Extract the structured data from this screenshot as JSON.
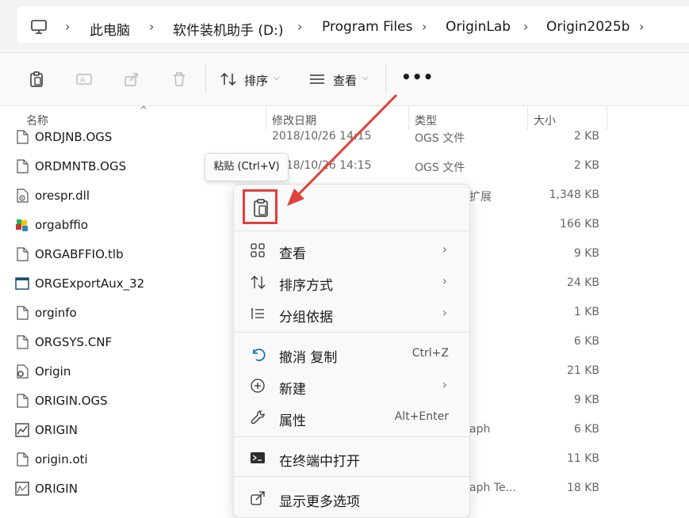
{
  "address": {
    "crumbs": [
      "此电脑",
      "软件装机助手 (D:)",
      "Program Files",
      "OriginLab",
      "Origin2025b"
    ]
  },
  "toolbar": {
    "sort_label": "排序",
    "view_label": "查看",
    "more_label": "•••"
  },
  "columns": {
    "name": "名称",
    "date": "修改日期",
    "type": "类型",
    "size": "大小"
  },
  "files": [
    {
      "name": "ORDJNB.OGS",
      "date": "2018/10/26 14:15",
      "type": "OGS 文件",
      "size": "2 KB",
      "icon": "file-icon"
    },
    {
      "name": "ORDMNTB.OGS",
      "date": "2018/10/26 14:15",
      "type": "OGS 文件",
      "size": "2 KB",
      "icon": "file-icon"
    },
    {
      "name": "orespr.dll",
      "date": "",
      "type": "扩展",
      "size": "1,348 KB",
      "icon": "dll-icon"
    },
    {
      "name": "orgabffio",
      "date": "",
      "type": "",
      "size": "166 KB",
      "icon": "app-color-icon"
    },
    {
      "name": "ORGABFFIO.tlb",
      "date": "",
      "type": "",
      "size": "9 KB",
      "icon": "file-icon"
    },
    {
      "name": "ORGExportAux_32",
      "date": "",
      "type": "",
      "size": "24 KB",
      "icon": "window-app-icon"
    },
    {
      "name": "orginfo",
      "date": "",
      "type": "",
      "size": "1 KB",
      "icon": "file-icon"
    },
    {
      "name": "ORGSYS.CNF",
      "date": "",
      "type": "",
      "size": "6 KB",
      "icon": "file-icon"
    },
    {
      "name": "Origin",
      "date": "",
      "type": "",
      "size": "21 KB",
      "icon": "settings-file-icon"
    },
    {
      "name": "ORIGIN.OGS",
      "date": "",
      "type": "",
      "size": "9 KB",
      "icon": "file-icon"
    },
    {
      "name": "ORIGIN",
      "date": "",
      "type": "aph",
      "size": "6 KB",
      "icon": "graph-app-icon"
    },
    {
      "name": "origin.oti",
      "date": "",
      "type": "",
      "size": "11 KB",
      "icon": "file-icon"
    },
    {
      "name": "ORIGIN",
      "date": "",
      "type": "aph Te...",
      "size": "18 KB",
      "icon": "graph-template-icon"
    }
  ],
  "tooltip": "粘贴 (Ctrl+V)",
  "menu": {
    "items": [
      {
        "label": "查看",
        "shortcut": "",
        "submenu": true,
        "icon": "grid-icon"
      },
      {
        "label": "排序方式",
        "shortcut": "",
        "submenu": true,
        "icon": "sort-icon"
      },
      {
        "label": "分组依据",
        "shortcut": "",
        "submenu": true,
        "icon": "group-icon"
      },
      {
        "label": "撤消 复制",
        "shortcut": "Ctrl+Z",
        "submenu": false,
        "icon": "undo-icon"
      },
      {
        "label": "新建",
        "shortcut": "",
        "submenu": true,
        "icon": "plus-circle-icon"
      },
      {
        "label": "属性",
        "shortcut": "Alt+Enter",
        "submenu": false,
        "icon": "wrench-icon"
      },
      {
        "label": "在终端中打开",
        "shortcut": "",
        "submenu": false,
        "icon": "terminal-icon"
      },
      {
        "label": "显示更多选项",
        "shortcut": "",
        "submenu": false,
        "icon": "share-icon"
      }
    ]
  },
  "colors": {
    "highlight": "#e0413a",
    "accent": "#0067c0"
  }
}
